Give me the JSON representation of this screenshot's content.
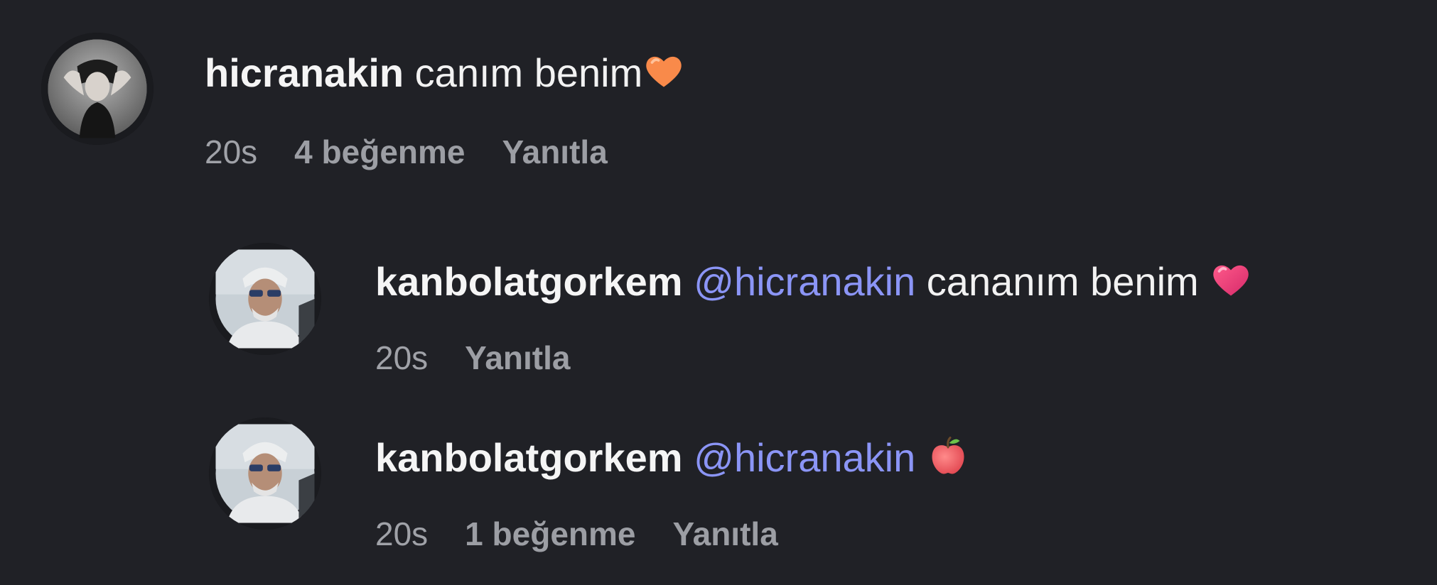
{
  "comments": [
    {
      "username": "hicranakin",
      "mention": "",
      "text": "canım benim",
      "emoji": "orange-heart-icon",
      "time": "20s",
      "likes": "4 beğenme",
      "reply": "Yanıtla"
    },
    {
      "username": "kanbolatgorkem",
      "mention": "@hicranakin",
      "text": "cananım benim",
      "emoji": "pink-heart-icon",
      "time": "20s",
      "likes": "",
      "reply": "Yanıtla"
    },
    {
      "username": "kanbolatgorkem",
      "mention": "@hicranakin",
      "text": "",
      "emoji": "apple-icon",
      "time": "20s",
      "likes": "1 beğenme",
      "reply": "Yanıtla"
    }
  ],
  "colors": {
    "background": "#202126",
    "mention": "#8b95f6",
    "meta": "#9c9ea4",
    "orange_heart": "#f98a4a",
    "pink_heart": "#f0457a",
    "apple": "#f2646a"
  }
}
